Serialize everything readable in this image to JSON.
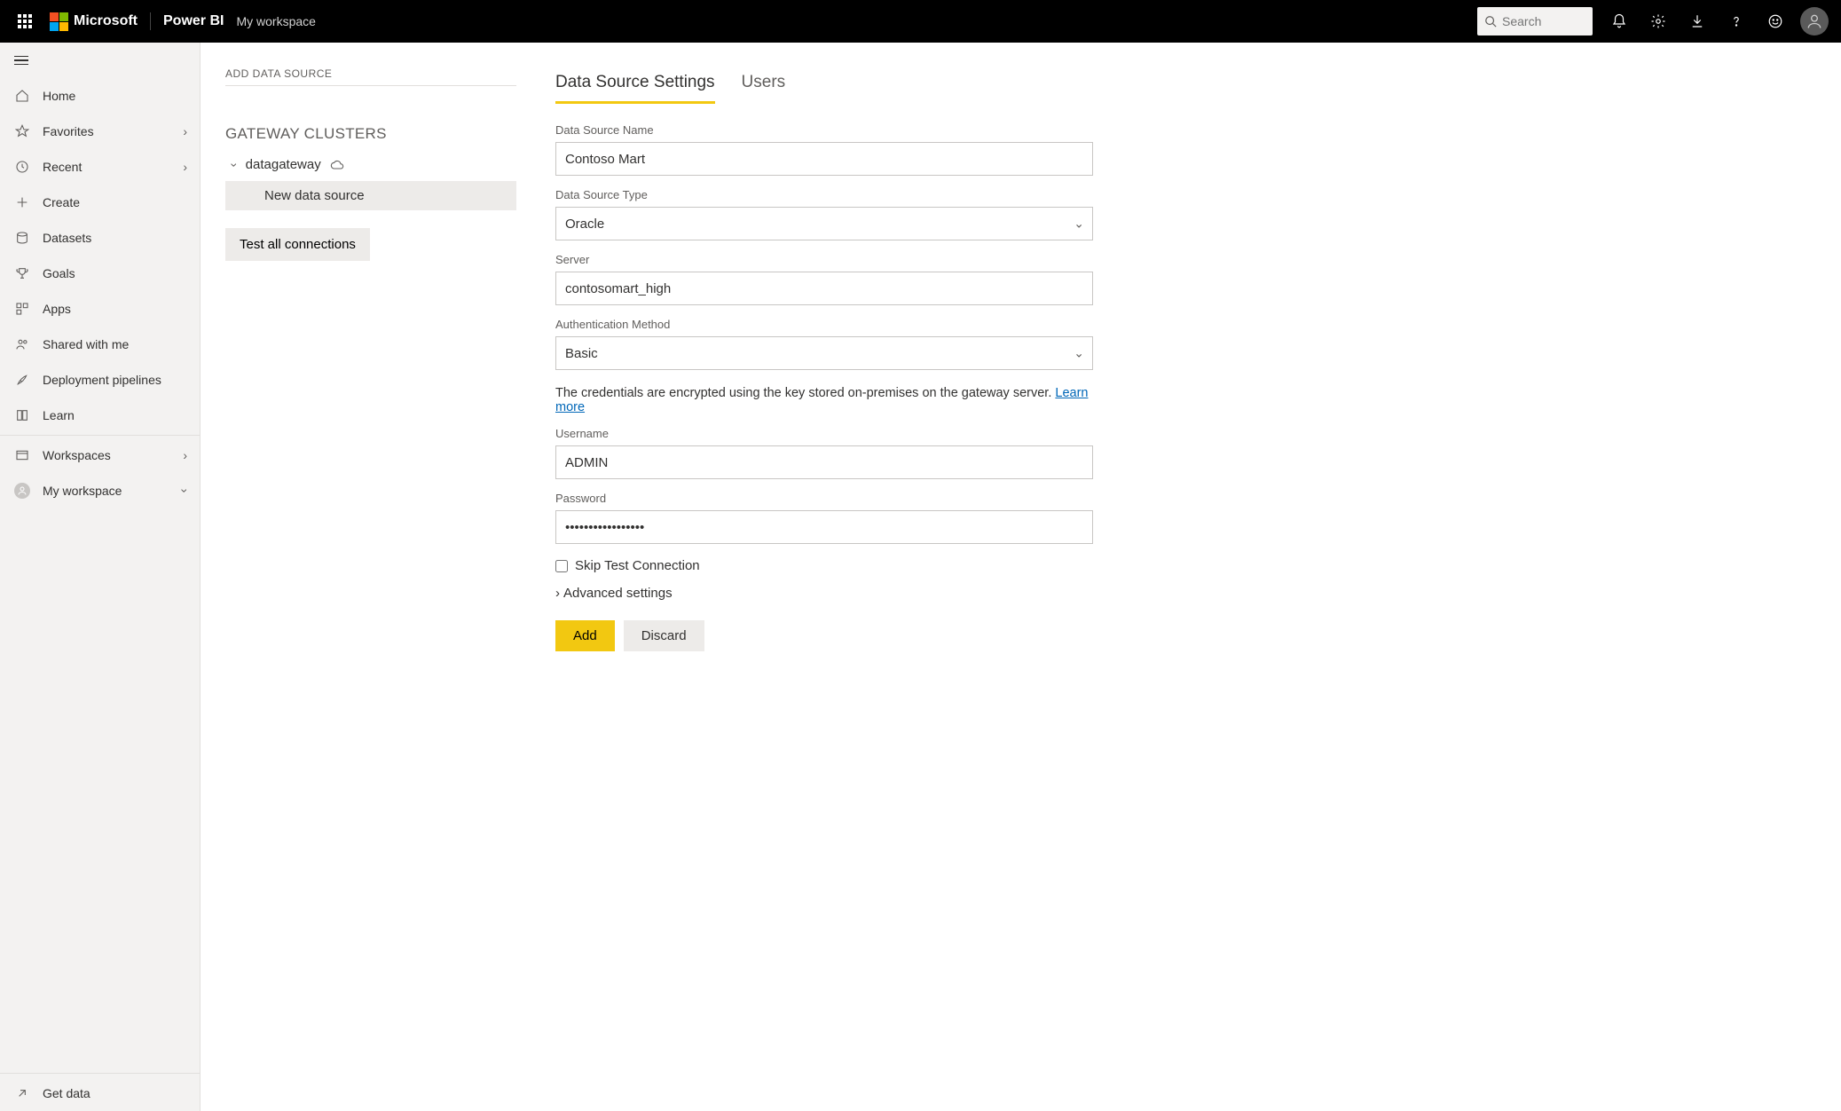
{
  "header": {
    "ms": "Microsoft",
    "brand": "Power BI",
    "breadcrumb": "My workspace",
    "search_placeholder": "Search"
  },
  "nav": {
    "items": [
      {
        "label": "Home"
      },
      {
        "label": "Favorites"
      },
      {
        "label": "Recent"
      },
      {
        "label": "Create"
      },
      {
        "label": "Datasets"
      },
      {
        "label": "Goals"
      },
      {
        "label": "Apps"
      },
      {
        "label": "Shared with me"
      },
      {
        "label": "Deployment pipelines"
      },
      {
        "label": "Learn"
      }
    ],
    "workspaces": "Workspaces",
    "myworkspace": "My workspace",
    "getdata": "Get data"
  },
  "gateway": {
    "page_sub": "ADD DATA SOURCE",
    "clusters_title": "GATEWAY CLUSTERS",
    "cluster_name": "datagateway",
    "new_source": "New data source",
    "test_all": "Test all connections"
  },
  "form": {
    "tabs": {
      "settings": "Data Source Settings",
      "users": "Users"
    },
    "labels": {
      "name": "Data Source Name",
      "type": "Data Source Type",
      "server": "Server",
      "auth": "Authentication Method",
      "user": "Username",
      "pass": "Password"
    },
    "values": {
      "name": "Contoso Mart",
      "type": "Oracle",
      "server": "contosomart_high",
      "auth": "Basic",
      "user": "ADMIN",
      "pass": "•••••••••••••••••"
    },
    "info": "The credentials are encrypted using the key stored on-premises on the gateway server. ",
    "learn_more": "Learn more",
    "skip_test": "Skip Test Connection",
    "advanced": "Advanced settings",
    "add": "Add",
    "discard": "Discard"
  }
}
